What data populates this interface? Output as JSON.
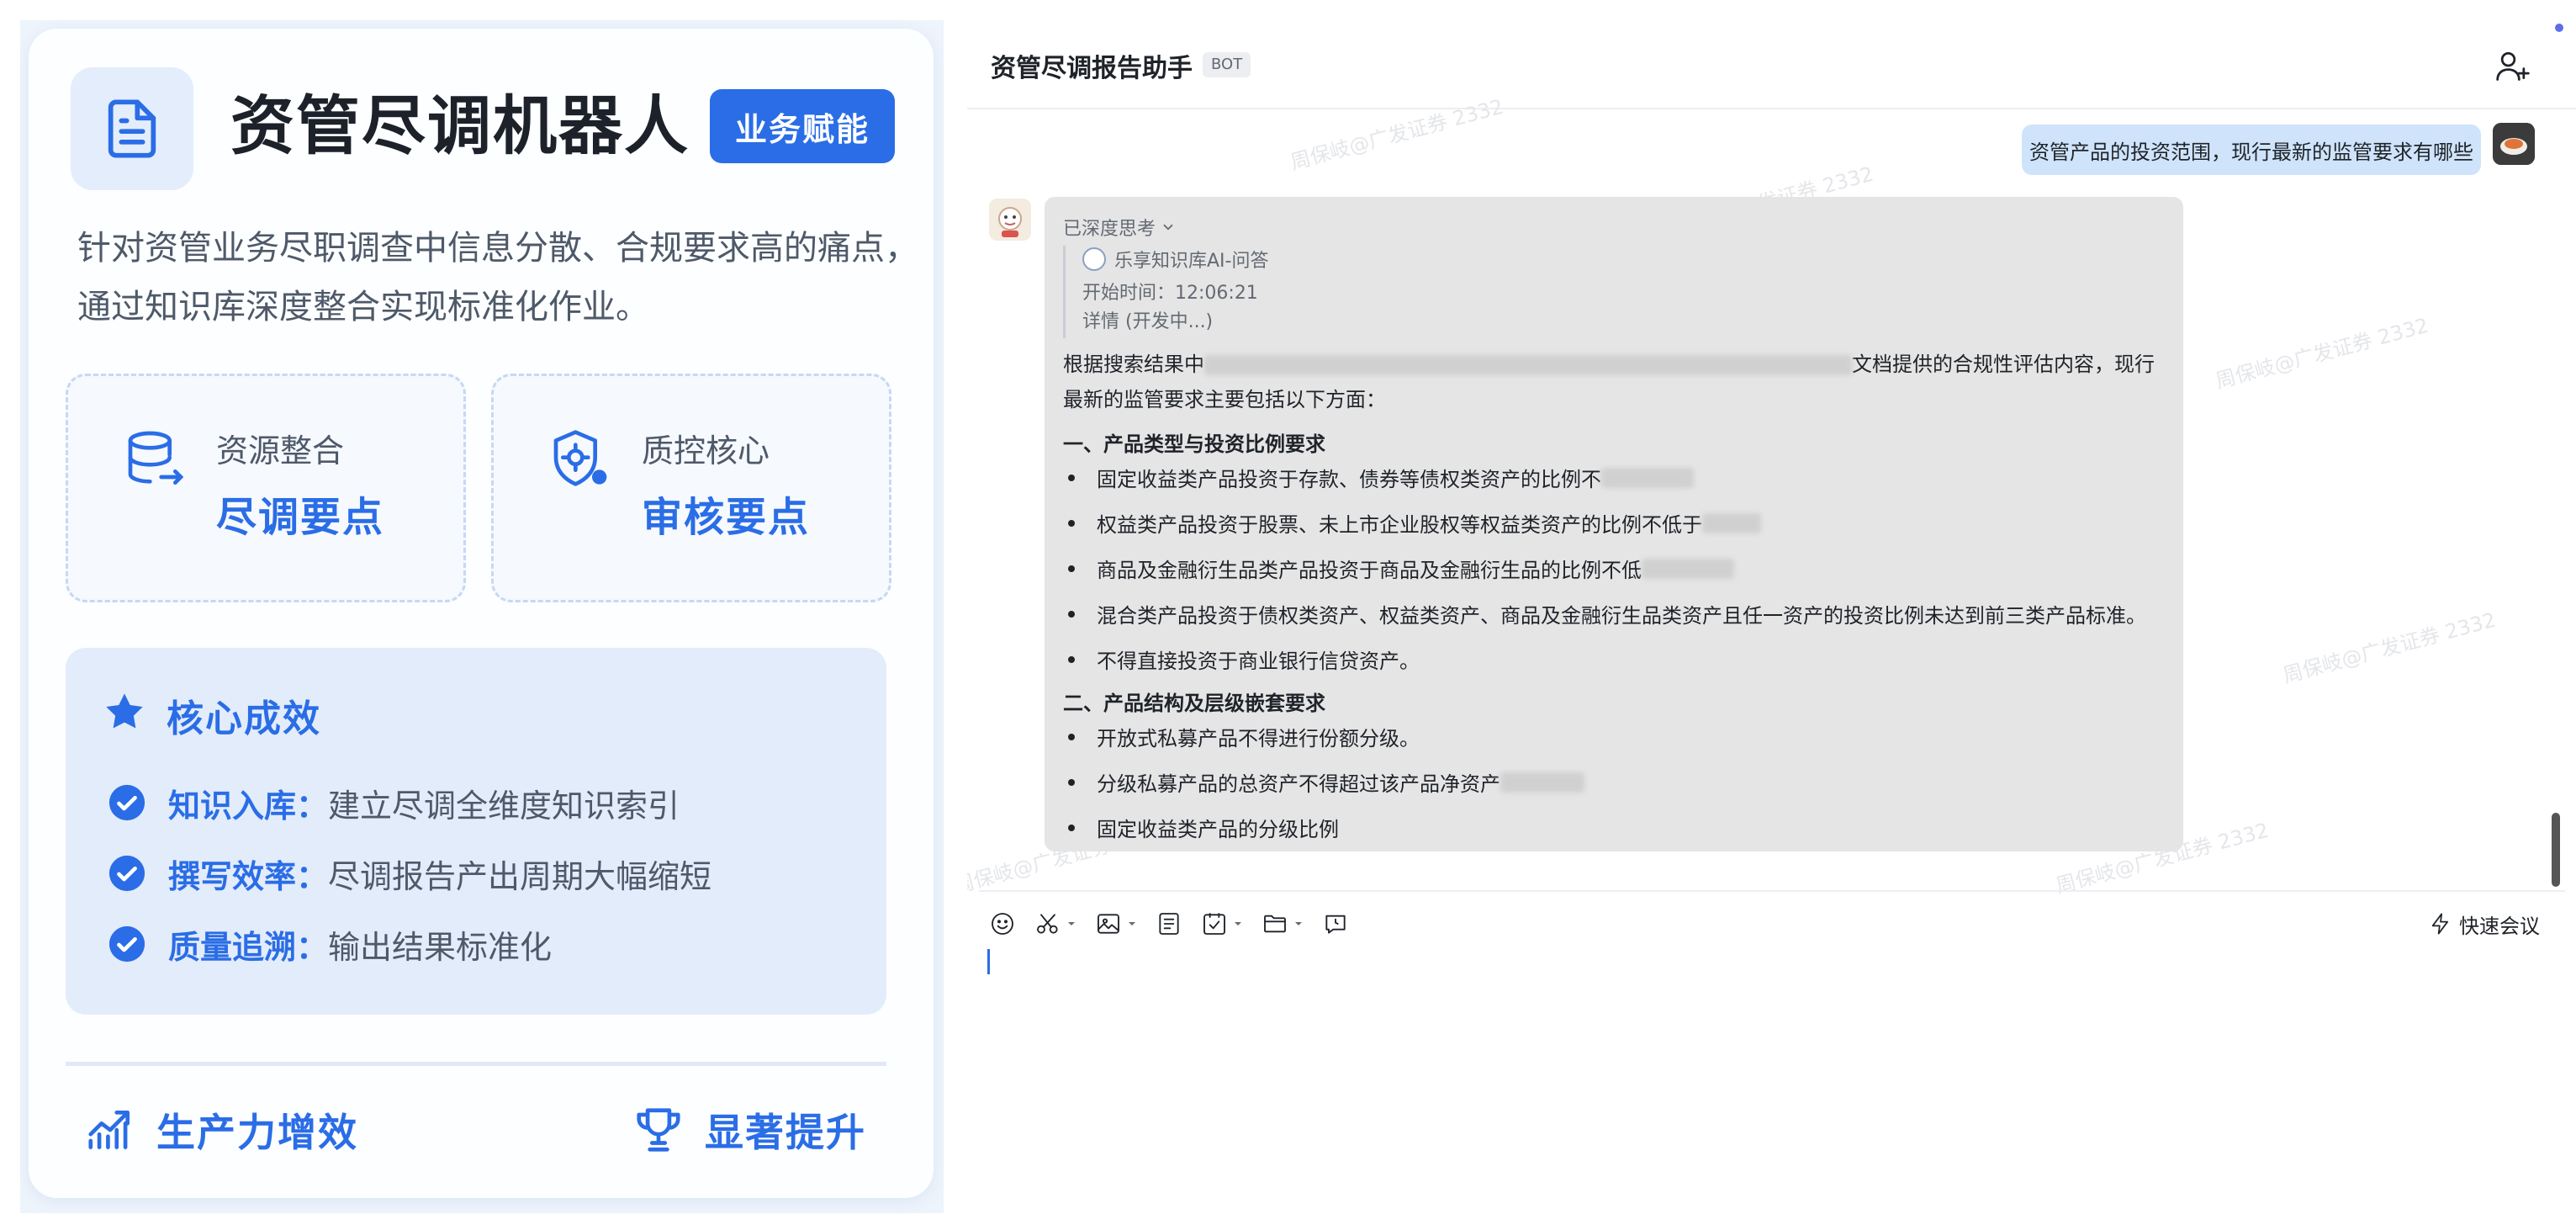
{
  "promo": {
    "title": "资管尽调机器人",
    "badge": "业务赋能",
    "description": "针对资管业务尽职调查中信息分散、合规要求高的痛点，通过知识库深度整合实现标准化作业。",
    "features": [
      {
        "label": "资源整合",
        "value": "尽调要点",
        "icon": "database-icon"
      },
      {
        "label": "质控核心",
        "value": "审核要点",
        "icon": "gear-shield-icon"
      }
    ],
    "core": {
      "title": "核心成效",
      "items": [
        {
          "key": "知识入库：",
          "value": "建立尽调全维度知识索引"
        },
        {
          "key": "撰写效率：",
          "value": "尽调报告产出周期大幅缩短"
        },
        {
          "key": "质量追溯：",
          "value": "输出结果标准化"
        }
      ]
    },
    "stats": [
      {
        "label": "生产力增效",
        "icon": "chart-trend-icon"
      },
      {
        "label": "显著提升",
        "icon": "trophy-icon"
      }
    ]
  },
  "chat": {
    "title": "资管尽调报告助手",
    "bot_tag": "BOT",
    "watermark": "周保岐@广发证券 2332",
    "user_message": "资管产品的投资范围，现行最新的监管要求有哪些",
    "bot": {
      "thinking_label": "已深度思考",
      "kb_name": "乐享知识库AI-问答",
      "start_time": "开始时间：12:06:21",
      "detail": "详情 (开发中...)",
      "intro_a": "根据搜索结果中",
      "intro_b": "文档提供的合规性评估内容，现行最新的监管要求主要包括以下方面：",
      "section1": "一、产品类型与投资比例要求",
      "bullets1": [
        "固定收益类产品投资于存款、债券等债权类资产的比例不",
        "权益类产品投资于股票、未上市企业股权等权益类资产的比例不低于",
        "商品及金融衍生品类产品投资于商品及金融衍生品的比例不低",
        "混合类产品投资于债权类资产、权益类资产、商品及金融衍生品类资产且任一资产的投资比例未达到前三类产品标准。",
        "不得直接投资于商业银行信贷资产。"
      ],
      "section2": "二、产品结构及层级嵌套要求",
      "bullets2": [
        "开放式私募产品不得进行份额分级。",
        "分级私募产品的总资产不得超过该产品净资产",
        "固定收益类产品的分级比例"
      ]
    },
    "toolbar": {
      "quick_meeting": "快速会议"
    }
  },
  "colors": {
    "accent": "#2a6de6",
    "user_bubble": "#cfe4fb",
    "bot_bubble": "#e5e5e5"
  }
}
